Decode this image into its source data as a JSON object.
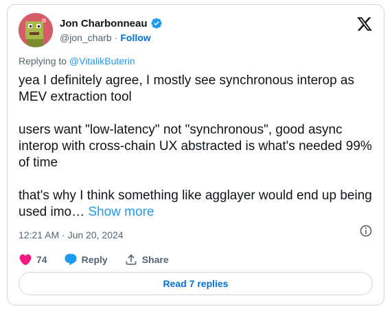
{
  "author": {
    "name": "Jon Charbonneau",
    "handle": "@jon_charb",
    "separator": "·",
    "follow_label": "Follow"
  },
  "replying": {
    "prefix": "Replying to ",
    "target": "@VitalikButerin"
  },
  "tweet": {
    "para1": "yea I definitely agree, I mostly see synchronous interop as MEV extraction tool",
    "para2": "users want \"low-latency\" not \"synchronous\", good async interop with cross-chain UX abstracted is what's needed 99% of time",
    "para3": "that's why I think something like agglayer would end up being used imo… ",
    "show_more": "Show more"
  },
  "meta": {
    "timestamp": "12:21 AM · Jun 20, 2024"
  },
  "actions": {
    "likes": "74",
    "reply_label": "Reply",
    "share_label": "Share"
  },
  "footer": {
    "read_replies": "Read 7 replies"
  },
  "colors": {
    "accent": "#1d9bf0",
    "like": "#f91880",
    "muted": "#536471",
    "avatar_bg": "#c94f5c"
  },
  "icons": [
    "verified-badge-icon",
    "x-logo-icon",
    "info-icon",
    "heart-icon",
    "reply-bubble-icon",
    "share-icon"
  ]
}
